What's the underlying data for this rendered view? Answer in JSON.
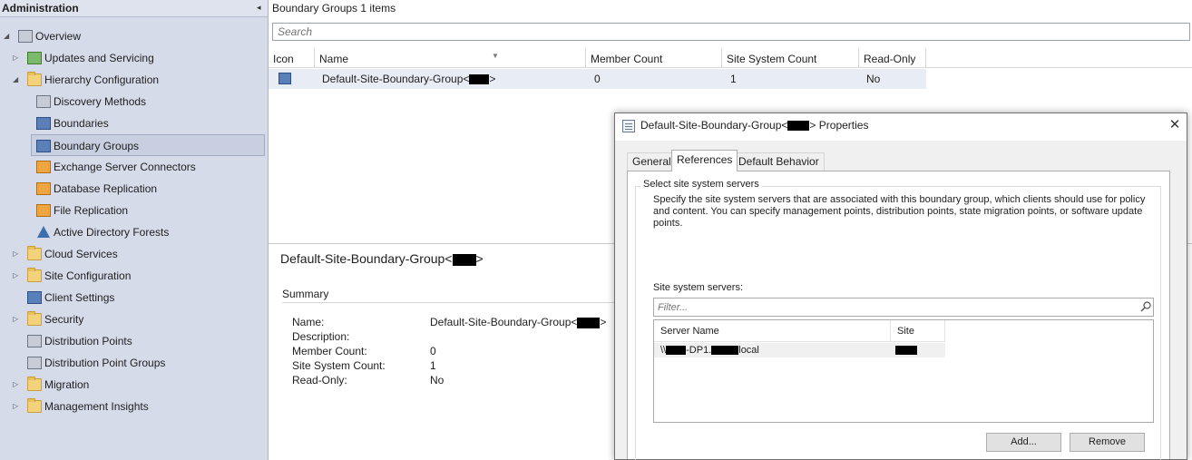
{
  "nav": {
    "title": "Administration",
    "collapse_glyph": "◂",
    "items": [
      {
        "label": "Overview",
        "icon": "overview-icon",
        "expanded": true
      },
      {
        "label": "Updates and Servicing",
        "icon": "updates-icon"
      },
      {
        "label": "Hierarchy Configuration",
        "icon": "folder-icon",
        "expanded": true
      },
      {
        "label": "Discovery Methods",
        "icon": "discovery-methods-icon"
      },
      {
        "label": "Boundaries",
        "icon": "boundaries-icon"
      },
      {
        "label": "Boundary Groups",
        "icon": "boundary-groups-icon",
        "selected": true
      },
      {
        "label": "Exchange Server Connectors",
        "icon": "exchange-connector-icon"
      },
      {
        "label": "Database Replication",
        "icon": "database-replication-icon"
      },
      {
        "label": "File Replication",
        "icon": "file-replication-icon"
      },
      {
        "label": "Active Directory Forests",
        "icon": "ad-forest-icon"
      },
      {
        "label": "Cloud Services",
        "icon": "folder-icon"
      },
      {
        "label": "Site Configuration",
        "icon": "folder-icon"
      },
      {
        "label": "Client Settings",
        "icon": "client-settings-icon"
      },
      {
        "label": "Security",
        "icon": "folder-icon"
      },
      {
        "label": "Distribution Points",
        "icon": "distribution-points-icon"
      },
      {
        "label": "Distribution Point Groups",
        "icon": "distribution-point-groups-icon"
      },
      {
        "label": "Migration",
        "icon": "folder-icon"
      },
      {
        "label": "Management Insights",
        "icon": "folder-icon"
      }
    ]
  },
  "main": {
    "title": "Boundary Groups",
    "count": "1 items",
    "search_placeholder": "Search",
    "columns": [
      "Icon",
      "Name",
      "Member Count",
      "Site System Count",
      "Read-Only"
    ],
    "rows": [
      {
        "name_prefix": "Default-Site-Boundary-Group<",
        "name_suffix": ">",
        "member_count": "0",
        "site_system_count": "1",
        "read_only": "No"
      }
    ]
  },
  "details": {
    "title_prefix": "Default-Site-Boundary-Group<",
    "title_suffix": ">",
    "summary_label": "Summary",
    "fields": [
      {
        "key": "Name:",
        "value_prefix": "Default-Site-Boundary-Group<",
        "value_suffix": ">"
      },
      {
        "key": "Description:",
        "value_prefix": "",
        "value_suffix": ""
      },
      {
        "key": "Member Count:",
        "value_prefix": "0",
        "value_suffix": ""
      },
      {
        "key": "Site System Count:",
        "value_prefix": "1",
        "value_suffix": ""
      },
      {
        "key": "Read-Only:",
        "value_prefix": "No",
        "value_suffix": ""
      }
    ]
  },
  "dialog": {
    "title_prefix": "Default-Site-Boundary-Group<",
    "title_suffix": "> Properties",
    "close_glyph": "✕",
    "tabs": [
      "General",
      "References",
      "Default Behavior"
    ],
    "active_tab": "References",
    "group_title": "Select site system servers",
    "description": "Specify the site system servers that are associated with this boundary group, which clients should use for policy and content. You can specify management points, distribution points, state migration points, or software update points.",
    "servers_label": "Site system servers:",
    "filter_placeholder": "Filter...",
    "list_columns": [
      "Server Name",
      "Site"
    ],
    "server_row": {
      "prefix": "\\\\",
      "middle": "-DP1.",
      "suffix": "local"
    },
    "buttons": {
      "add": "Add...",
      "remove": "Remove"
    }
  },
  "colors": {
    "nav_background": "#d6dbe9",
    "selection": "#c7cfe0",
    "row_highlight": "#e8ecf5",
    "dialog_body": "#f0f0f0"
  }
}
